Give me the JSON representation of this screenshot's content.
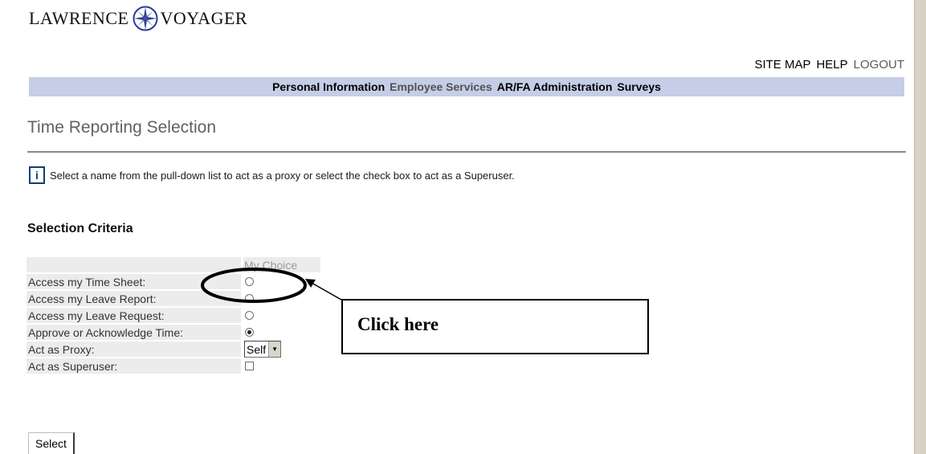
{
  "logo": {
    "word1": "LAWRENCE",
    "word2": "VOYAGER"
  },
  "utility_nav": {
    "site_map": "SITE MAP",
    "help": "HELP",
    "logout": "LOGOUT"
  },
  "main_nav": {
    "items": [
      "Personal Information",
      "Employee Services",
      "AR/FA Administration",
      "Surveys"
    ]
  },
  "page_title": "Time Reporting Selection",
  "info_text": "Select a name from the pull-down list to act as a proxy or select the check box to act as a Superuser.",
  "section_heading": "Selection Criteria",
  "criteria": {
    "column_header": "My Choice",
    "rows": [
      {
        "label": "Access my Time Sheet:",
        "control": "radio",
        "checked": false
      },
      {
        "label": "Access my Leave Report:",
        "control": "radio",
        "checked": false
      },
      {
        "label": "Access my Leave Request:",
        "control": "radio",
        "checked": false
      },
      {
        "label": "Approve or Acknowledge Time:",
        "control": "radio",
        "checked": true
      },
      {
        "label": "Act as Proxy:",
        "control": "select",
        "value": "Self"
      },
      {
        "label": "Act as Superuser:",
        "control": "checkbox",
        "checked": false
      }
    ]
  },
  "select_button": "Select",
  "annotation": {
    "callout_text": "Click here"
  },
  "colors": {
    "nav_bar": "#c6cde6",
    "label_bg": "#ececec",
    "info_icon": "#123e78"
  },
  "icons": {
    "info": "info-icon",
    "logo_mark": "compass-star-icon",
    "dropdown": "chevron-down-icon"
  }
}
